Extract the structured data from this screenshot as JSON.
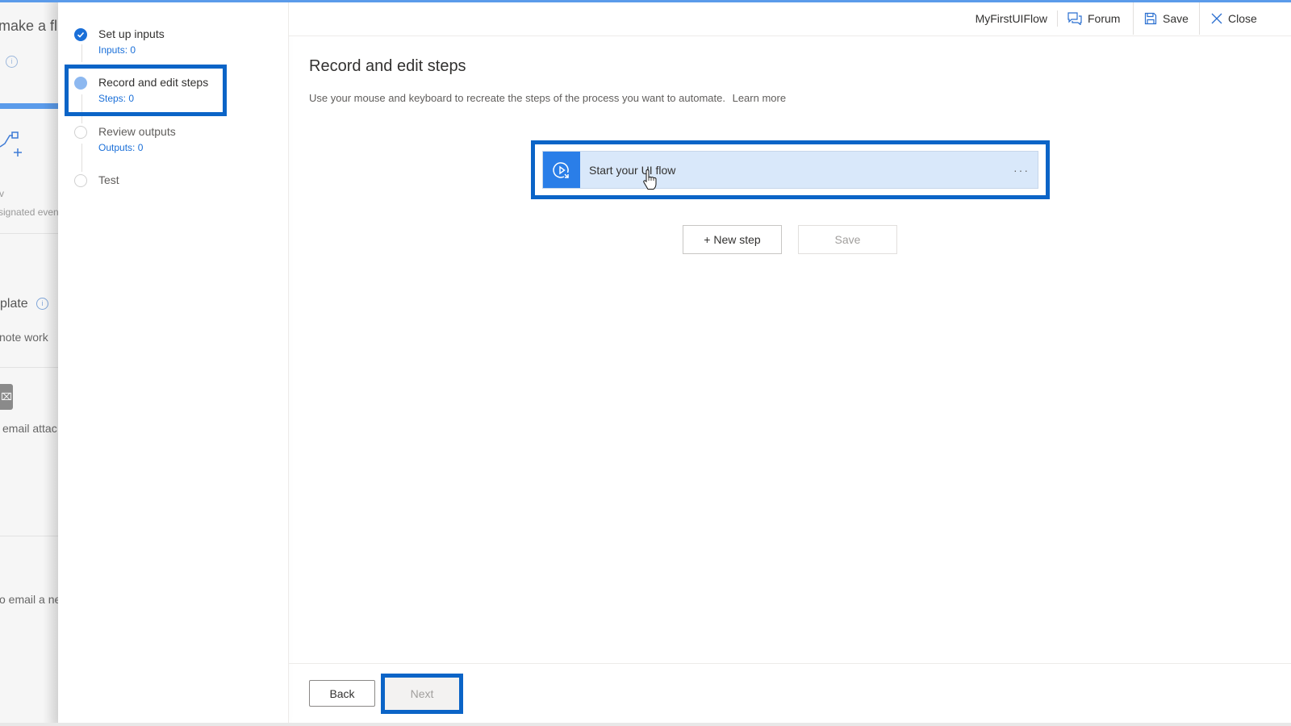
{
  "background_page": {
    "title_fragment": "make a fl",
    "subtitle_fragment_1": "v",
    "subtitle_fragment_2": "signated even",
    "template_heading_fragment": "plate",
    "template_desc_fragment": "note work",
    "template_item_fragment": "email attac",
    "template_item2_fragment": "o email a ne"
  },
  "wizard": {
    "steps": [
      {
        "label": "Set up inputs",
        "sub": "Inputs: 0",
        "state": "done"
      },
      {
        "label": "Record and edit steps",
        "sub": "Steps: 0",
        "state": "current"
      },
      {
        "label": "Review outputs",
        "sub": "Outputs: 0",
        "state": "todo"
      },
      {
        "label": "Test",
        "sub": "",
        "state": "todo"
      }
    ]
  },
  "header": {
    "flow_name": "MyFirstUIFlow",
    "forum_label": "Forum",
    "save_label": "Save",
    "close_label": "Close"
  },
  "main": {
    "title": "Record and edit steps",
    "description": "Use your mouse and keyboard to recreate the steps of the process you want to automate.",
    "learn_more": "Learn more",
    "start_card_label": "Start your UI flow",
    "more_label": "···",
    "new_step_label": "+ New step",
    "save_label": "Save"
  },
  "footer": {
    "back_label": "Back",
    "next_label": "Next"
  },
  "colors": {
    "accent": "#0b64c7",
    "primary_blue": "#2a7ee8",
    "card_bg": "#d9e8fa",
    "link_blue": "#1a6fd8"
  }
}
